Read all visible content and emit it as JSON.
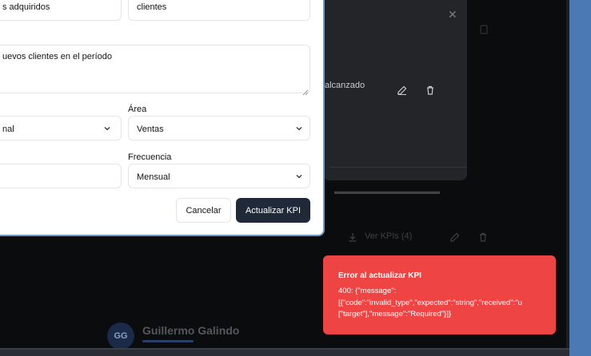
{
  "dialog": {
    "field_name": {
      "value": "s adquiridos"
    },
    "field_unit": {
      "value": "clientes"
    },
    "field_description": {
      "value": "uevos clientes en el período"
    },
    "field_type": {
      "value": "nal"
    },
    "field_area": {
      "label": "Área",
      "value": "Ventas"
    },
    "field_target": {
      "value": ""
    },
    "field_frequency": {
      "label": "Frecuencia",
      "value": "Mensual"
    },
    "cancel_label": "Cancelar",
    "submit_label": "Actualizar KPI"
  },
  "background": {
    "card_text": "alcanzado",
    "dim_link_1": "Ver KPIs (4)",
    "person_initials": "GG",
    "person_name": "Guillermo Galindo"
  },
  "toast": {
    "title": "Error al actualizar KPI",
    "message": "400: {\"message\":\n[{\"code\":\"invalid_type\",\"expected\":\"string\",\"received\":\"u\n[\"target\"],\"message\":\"Required\"}]}"
  },
  "colors": {
    "primary_button": "#1f2937",
    "toast_error": "#ef4444",
    "dialog_border": "#6b99bf",
    "desktop_accent": "#4a79b3"
  },
  "icons": [
    "close-icon",
    "edit-icon",
    "trash-icon",
    "chevron-down-icon",
    "resize-grip-icon"
  ]
}
